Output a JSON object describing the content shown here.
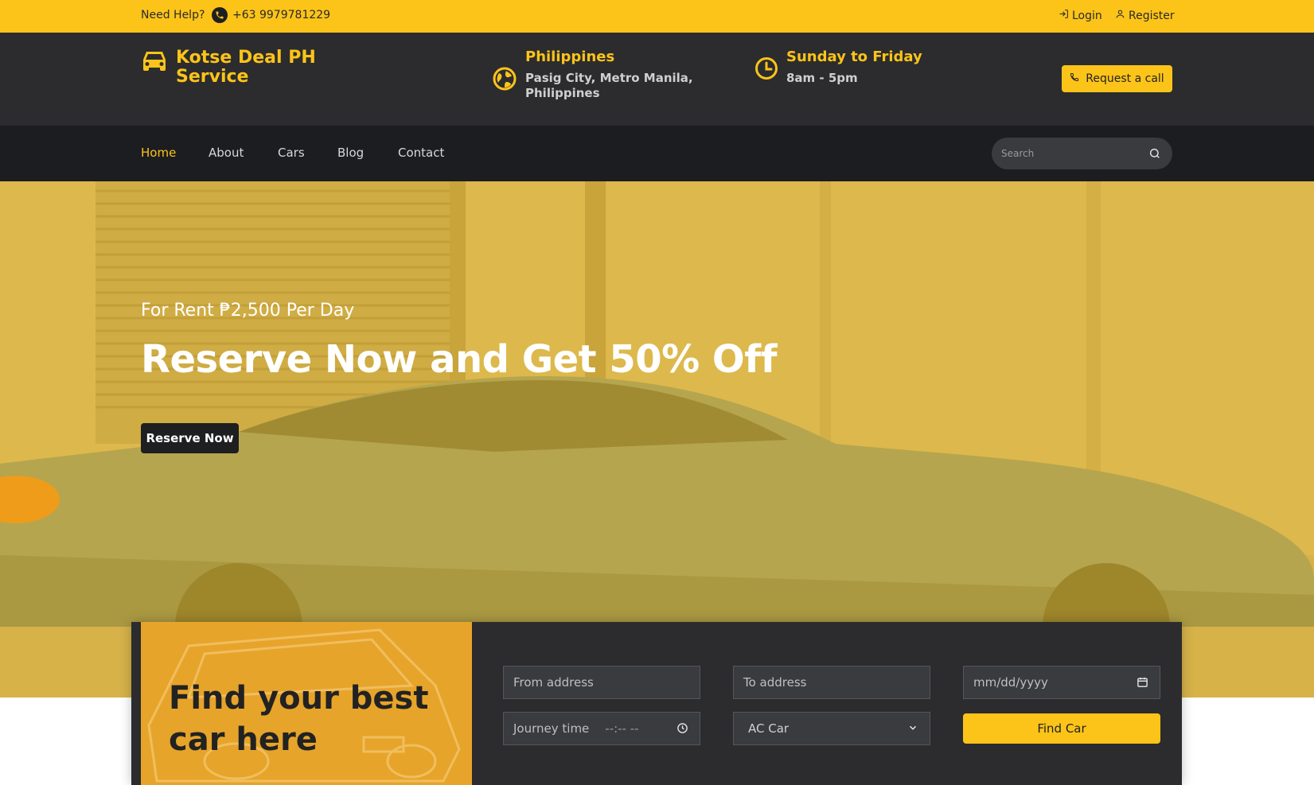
{
  "topbar": {
    "help_label": "Need Help?",
    "phone": "+63 9979781229",
    "login_label": "Login",
    "register_label": "Register"
  },
  "header": {
    "brand_line1": "Kotse Deal PH",
    "brand_line2": "Service",
    "location_title": "Philippines",
    "location_line1": "Pasig City, Metro Manila,",
    "location_line2": "Philippines",
    "hours_title": "Sunday to Friday",
    "hours_value": "8am - 5pm",
    "request_call_label": "Request a call"
  },
  "nav": {
    "items": [
      {
        "label": "Home",
        "active": true
      },
      {
        "label": "About"
      },
      {
        "label": "Cars"
      },
      {
        "label": "Blog"
      },
      {
        "label": "Contact"
      }
    ],
    "search_placeholder": "Search"
  },
  "hero": {
    "eyebrow": "For Rent ₱2,500 Per Day",
    "headline": "Reserve Now and Get 50% Off",
    "cta_label": "Reserve Now"
  },
  "booking": {
    "promo_line1": "Find your best",
    "promo_line2": "car here",
    "from_placeholder": "From address",
    "to_placeholder": "To address",
    "date_placeholder": "mm/dd/yyyy",
    "time_placeholder": "Journey time",
    "time_value": "--:-- --",
    "car_type_selected": "AC Car",
    "find_label": "Find Car"
  },
  "colors": {
    "accent": "#fcc419",
    "dark": "#2c2c2e",
    "nav": "#1c1d20"
  }
}
